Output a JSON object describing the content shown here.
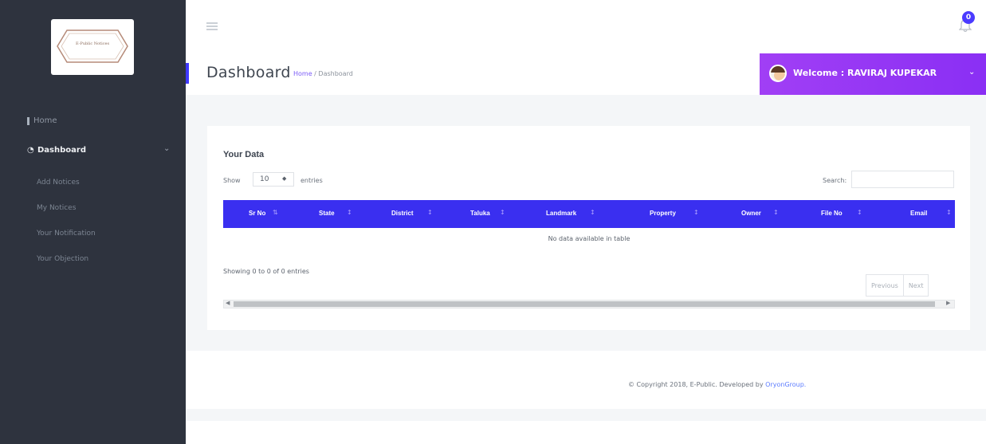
{
  "logo": {
    "text": "E-Public Notices"
  },
  "sidebar": {
    "home_label": "Home",
    "dashboard_label": "Dashboard",
    "sub_items": [
      {
        "label": "Add Notices"
      },
      {
        "label": "My Notices"
      },
      {
        "label": "Your Notification"
      },
      {
        "label": "Your Objection"
      }
    ]
  },
  "header": {
    "notification_count": "0",
    "welcome": "Welcome : RAVIRAJ KUPEKAR"
  },
  "page": {
    "title": "Dashboard",
    "breadcrumb_home": "Home",
    "breadcrumb_sep": " / ",
    "breadcrumb_current": "Dashboard"
  },
  "table": {
    "title": "Your Data",
    "show_label": "Show",
    "entries_value": "10",
    "entries_label": "entries",
    "search_label": "Search:",
    "columns": [
      "Sr No",
      "State",
      "District",
      "Taluka",
      "Landmark",
      "Property",
      "Owner",
      "File No",
      "Email"
    ],
    "empty_text": "No data available in table",
    "info": "Showing 0 to 0 of 0 entries",
    "previous": "Previous",
    "next": "Next"
  },
  "footer": {
    "copyright": "© Copyright 2018, E-Public. Developed by ",
    "developer": "OryonGroup."
  },
  "colors": {
    "sidebar": "#2e333e",
    "accent": "#3a2ff0",
    "welcome_gradient_start": "#a13ff5",
    "welcome_gradient_end": "#8a2ff4"
  }
}
